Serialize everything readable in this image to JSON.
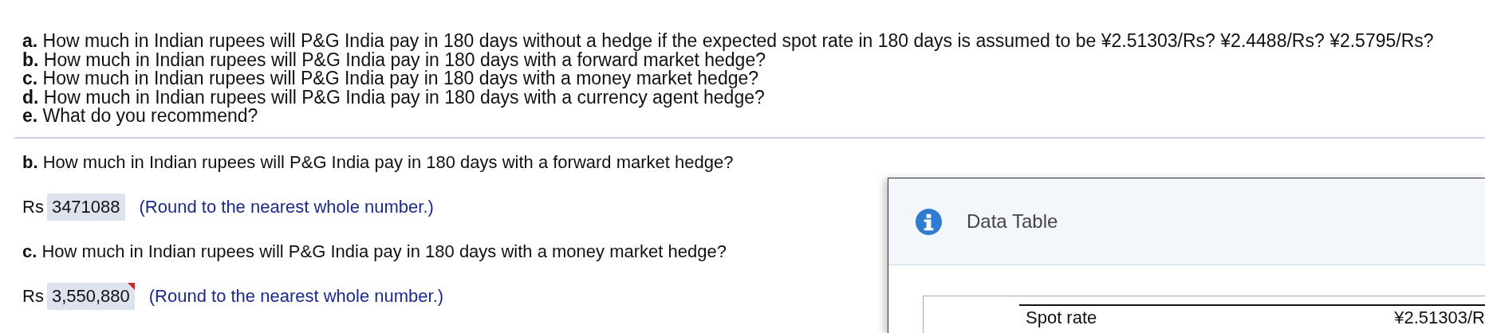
{
  "questions": [
    {
      "label": "a.",
      "text": "How much in Indian rupees will P&G India pay in 180 days without a hedge if the expected spot rate in 180 days is assumed to be ¥2.51303/Rs? ¥2.4488/Rs? ¥2.5795/Rs?"
    },
    {
      "label": "b.",
      "text": "How much in Indian rupees will P&G India pay in 180 days with a forward market hedge?"
    },
    {
      "label": "c.",
      "text": "How much in Indian rupees will P&G India pay in 180 days with a money market hedge?"
    },
    {
      "label": "d.",
      "text": "How much in Indian rupees will P&G India pay in 180 days with a currency agent hedge?"
    },
    {
      "label": "e.",
      "text": "What do you recommend?"
    }
  ],
  "parts": [
    {
      "label": "b.",
      "question": "How much in Indian rupees will P&G India pay in 180 days with a forward market hedge?",
      "prefix": "Rs",
      "value": "3471088",
      "flagged": false,
      "hint": "(Round to the nearest whole number.)"
    },
    {
      "label": "c.",
      "question": "How much in Indian rupees will P&G India pay in 180 days with a money market hedge?",
      "prefix": "Rs",
      "value": "3,550,880",
      "flagged": true,
      "hint": "(Round to the nearest whole number.)"
    }
  ],
  "dialog": {
    "title": "Data Table",
    "rows": [
      {
        "label": "Spot rate",
        "value": "¥2.51303/R"
      }
    ]
  }
}
